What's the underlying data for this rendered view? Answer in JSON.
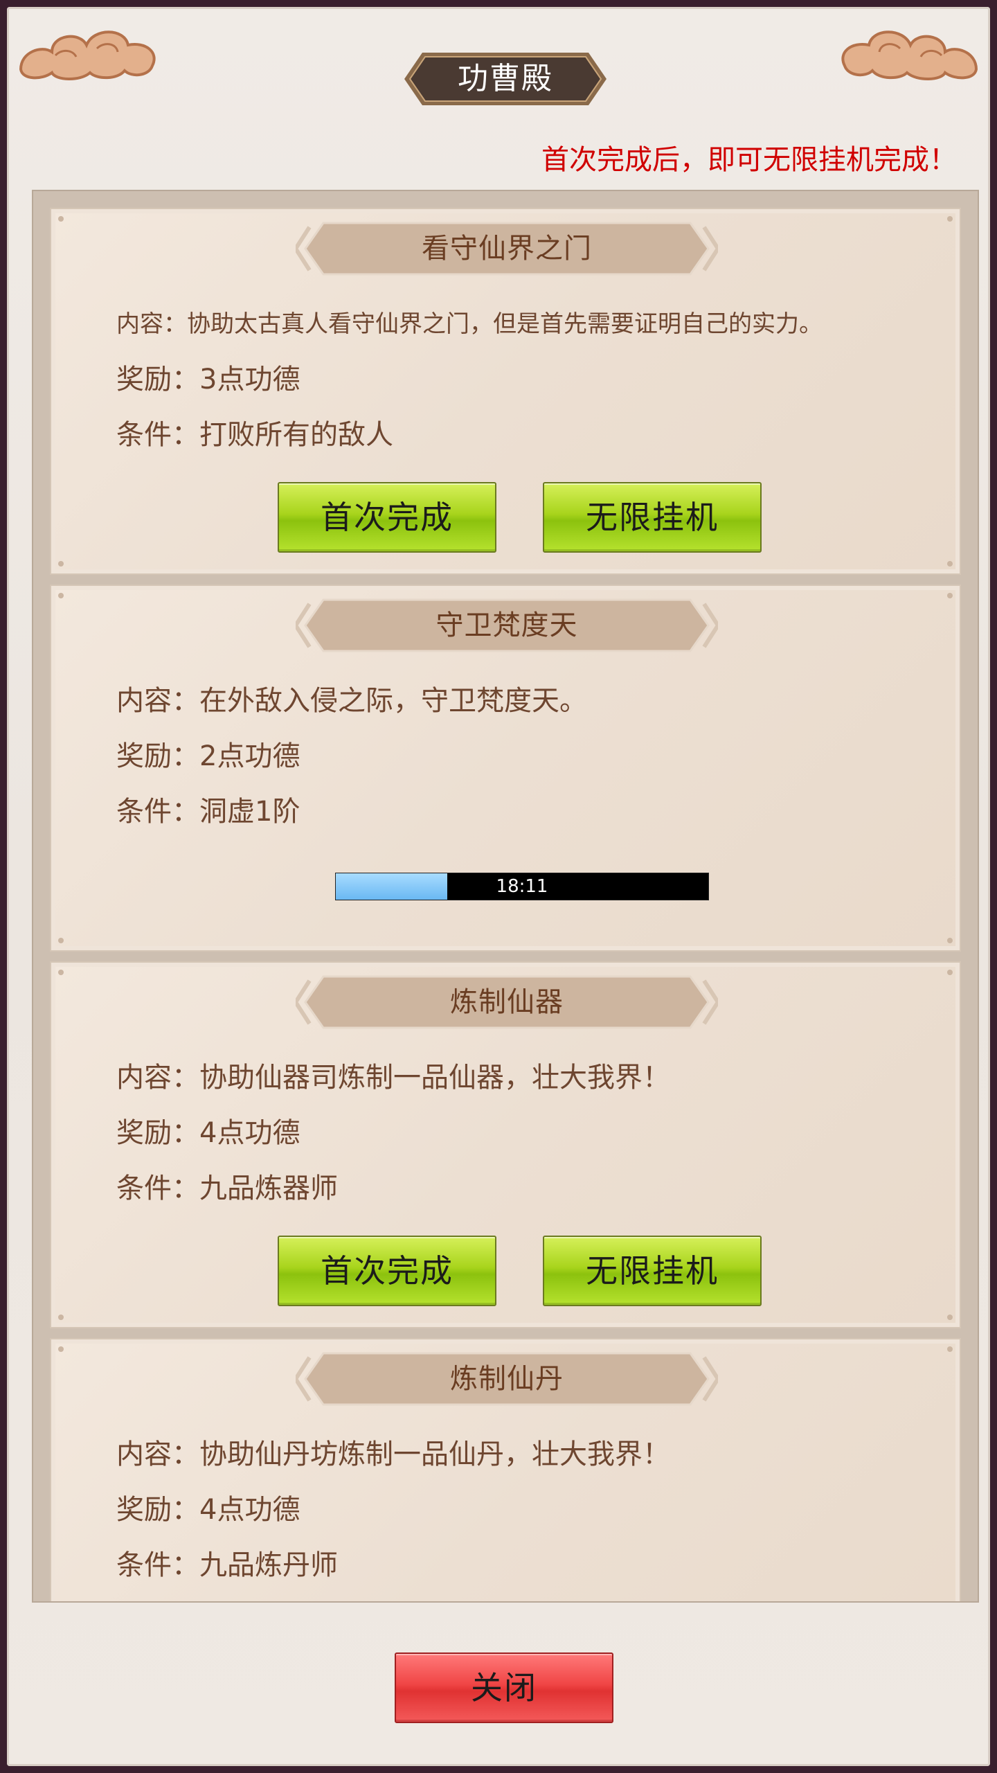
{
  "dialog": {
    "title": "功曹殿",
    "notice": "首次完成后，即可无限挂机完成！",
    "close_label": "关闭"
  },
  "labels": {
    "content": "内容：",
    "reward": "奖励：",
    "condition": "条件："
  },
  "tasks": [
    {
      "title": "看守仙界之门",
      "content": "协助太古真人看守仙界之门，但是首先需要证明自己的实力。",
      "reward": "3点功德",
      "condition": "打败所有的敌人",
      "first_complete_label": "首次完成",
      "idle_label": "无限挂机"
    },
    {
      "title": "守卫梵度天",
      "content": "在外敌入侵之际，守卫梵度天。",
      "reward": "2点功德",
      "condition": "洞虚1阶",
      "progress_text": "18:11",
      "progress_fraction": 0.3
    },
    {
      "title": "炼制仙器",
      "content": "协助仙器司炼制一品仙器，壮大我界！",
      "reward": "4点功德",
      "condition": "九品炼器师",
      "first_complete_label": "首次完成",
      "idle_label": "无限挂机"
    },
    {
      "title": "炼制仙丹",
      "content": "协助仙丹坊炼制一品仙丹，壮大我界！",
      "reward": "4点功德",
      "condition": "九品炼丹师"
    }
  ],
  "colors": {
    "notice": "#d00000",
    "title_text": "#6a3d22",
    "body_text": "#6e4630",
    "green_button": "#a8d41c",
    "red_button": "#f04545",
    "progress_fill": "#6ab8f2"
  }
}
